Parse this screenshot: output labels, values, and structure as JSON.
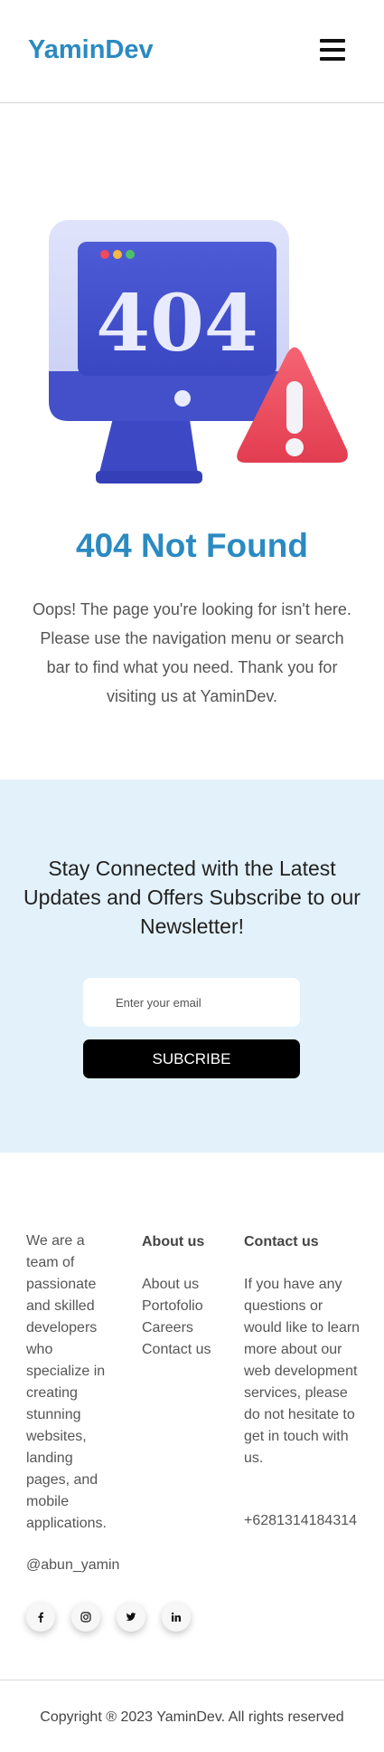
{
  "header": {
    "logo": "YaminDev",
    "menu_icon": "hamburger-icon"
  },
  "hero": {
    "illustration_text": "404",
    "title": "404 Not Found",
    "description": "Oops! The page you're looking for isn't here. Please use the navigation menu or search bar to find what you need. Thank you for visiting us at YaminDev.",
    "colors": {
      "accent": "#2b8ac1",
      "monitor": "#4452cc",
      "warning": "#ee4b5c"
    }
  },
  "newsletter": {
    "title": "Stay Connected with the Latest Updates and Offers Subscribe to our Newsletter!",
    "email_placeholder": "Enter your email",
    "email_value": "",
    "button_label": "SUBCRIBE",
    "background": "#e3f1fa"
  },
  "footer": {
    "about": "We are a team of passionate and skilled developers who specialize in creating stunning websites, landing pages, and mobile applications.",
    "handle": "@abun_yamin",
    "about_us": {
      "title": "About us",
      "links": [
        "About us",
        "Portofolio",
        "Careers",
        "Contact us"
      ]
    },
    "contact": {
      "title": "Contact us",
      "text": "If you have any questions or would like to learn more about our web development services, please do not hesitate to get in touch with us.",
      "phone": "+6281314184314"
    },
    "socials": [
      {
        "name": "facebook-icon",
        "glyph": "f"
      },
      {
        "name": "instagram-icon",
        "glyph": "ig"
      },
      {
        "name": "twitter-icon",
        "glyph": "tw"
      },
      {
        "name": "linkedin-icon",
        "glyph": "in"
      }
    ],
    "copyright": "Copyright ® 2023 YaminDev. All rights reserved"
  }
}
